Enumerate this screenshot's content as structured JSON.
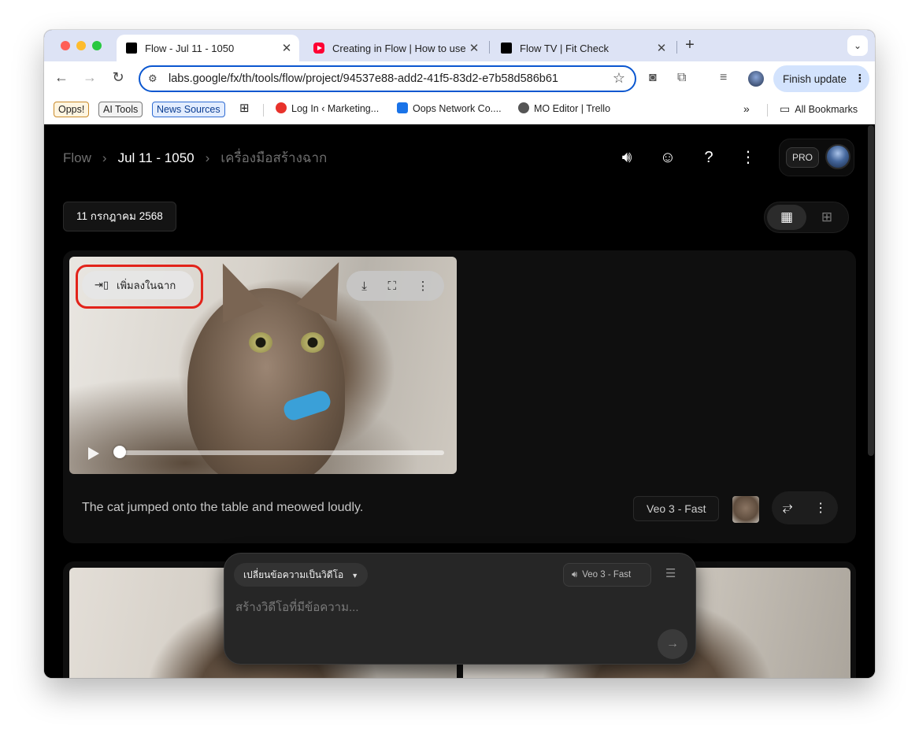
{
  "browser": {
    "tabs": [
      {
        "title": "Flow - Jul 11 - 1050",
        "active": true
      },
      {
        "title": "Creating in Flow | How to use",
        "active": false
      },
      {
        "title": "Flow TV | Fit Check",
        "active": false
      }
    ],
    "address": "labs.google/fx/th/tools/flow/project/94537e88-add2-41f5-83d2-e7b58d586b61",
    "finish_update": "Finish update",
    "bookmarks": {
      "opps": "Opps!",
      "ai_tools": "AI Tools",
      "news_sources": "News Sources",
      "login_marketing": "Log In ‹ Marketing...",
      "oops_network": "Oops Network Co....",
      "mo_editor": "MO Editor | Trello",
      "all_bookmarks": "All Bookmarks"
    }
  },
  "app": {
    "breadcrumb": {
      "root": "Flow",
      "project": "Jul 11 - 1050",
      "tool": "เครื่องมือสร้างฉาก"
    },
    "pro_badge": "PRO",
    "date_chip": "11 กรกฎาคม 2568",
    "card": {
      "add_to_scene": "เพิ่มลงในฉาก",
      "prompt": "The cat jumped onto the table and meowed loudly.",
      "model": "Veo 3 - Fast",
      "progress": 0.02
    },
    "composer": {
      "mode": "เปลี่ยนข้อความเป็นวิดีโอ",
      "model": "Veo 3 - Fast",
      "placeholder": "สร้างวิดีโอที่มีข้อความ..."
    }
  },
  "colors": {
    "accent_highlight": "#e2231a",
    "omnibox_border": "#0b57d0",
    "finish_update_bg": "#d3e3fd",
    "app_bg": "#000000"
  }
}
